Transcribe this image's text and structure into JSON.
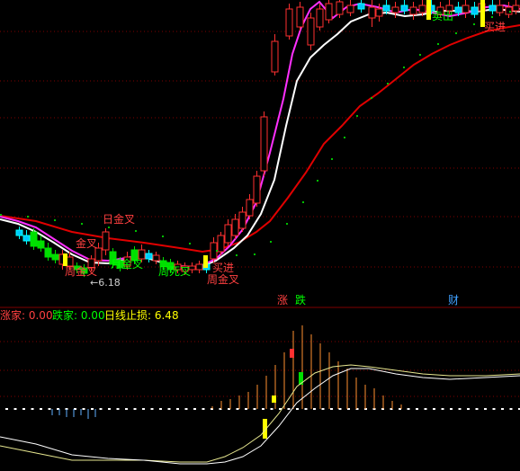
{
  "colors": {
    "background": "#000000",
    "grid": "#800000",
    "up": "#ff3030",
    "down": "#00ffff",
    "down_fill": "#00c8ff",
    "green_bar": "#00e000",
    "ma_white": "#ffffff",
    "ma_magenta": "#ff30ff",
    "ma_red": "#e00000",
    "dots": "#00c000",
    "signal_yellow": "#ffff00",
    "label_red": "#ff4040",
    "label_green": "#00ff00",
    "label_gray": "#cfcfcf",
    "text_blue": "#40a0ff",
    "ind_yellow_line": "#e8e890",
    "ind_white_line": "#ffffff",
    "bar_orange": "#ff9030",
    "bar_blue": "#60b0ff",
    "bar_white": "#ffffff"
  },
  "main_chart": {
    "annotations": [
      {
        "text": "日金叉",
        "color": "label_red"
      },
      {
        "text": "金叉",
        "color": "label_red"
      },
      {
        "text": "月金叉",
        "color": "label_green"
      },
      {
        "text": "周金叉",
        "color": "label_red"
      },
      {
        "text": "周死叉",
        "color": "label_green"
      },
      {
        "text": "买进",
        "color": "label_red"
      },
      {
        "text": "周金叉",
        "color": "label_red"
      },
      {
        "text": "卖出",
        "color": "label_green"
      },
      {
        "text": "买进",
        "color": "label_red"
      }
    ],
    "low_marker": "←6.18",
    "bottom_tags": [
      {
        "text": "涨",
        "color": "label_red"
      },
      {
        "text": "跌",
        "color": "label_green"
      },
      {
        "text": "财",
        "color": "text_blue"
      }
    ]
  },
  "indicator": {
    "header": [
      {
        "label": "涨家: 0.00",
        "color": "label_red"
      },
      {
        "label": "跌家: 0.00",
        "color": "label_green"
      },
      {
        "label": "日线止损: 6.48",
        "color": "signal_yellow"
      }
    ]
  },
  "chart_data": [
    {
      "type": "candlestick",
      "title": "",
      "low_label": 6.18,
      "ma_lines": [
        "white",
        "magenta",
        "red"
      ],
      "note": "daily candles with white, magenta and red moving averages and green dotted line"
    },
    {
      "type": "bar",
      "title": "",
      "series": [
        {
          "name": "涨家",
          "values": [
            0.0
          ]
        },
        {
          "name": "跌家",
          "values": [
            0.0
          ]
        },
        {
          "name": "日线止损",
          "values": [
            6.48
          ]
        }
      ]
    }
  ]
}
